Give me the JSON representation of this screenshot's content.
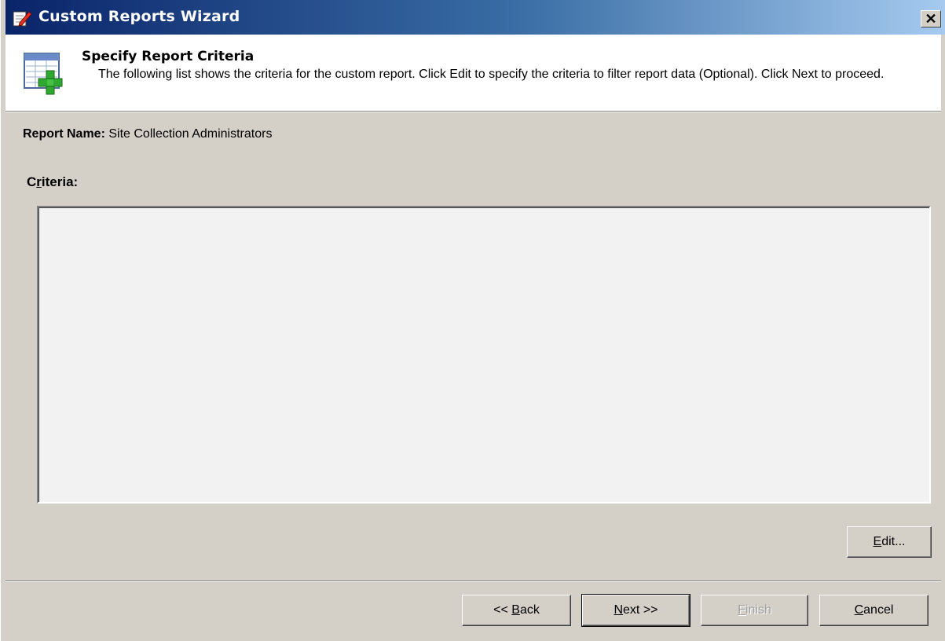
{
  "window": {
    "title": "Custom Reports Wizard",
    "close_label": "✕"
  },
  "header": {
    "title": "Specify Report Criteria",
    "description": "The following list shows the criteria for the custom report. Click Edit to specify the criteria to filter report data (Optional). Click Next to proceed."
  },
  "report": {
    "name_label": "Report Name:",
    "name_value": "Site Collection Administrators"
  },
  "criteria": {
    "label_prefix": "C",
    "label_accel": "r",
    "label_suffix": "iteria:",
    "items": []
  },
  "buttons": {
    "edit": {
      "accel": "E",
      "rest": "dit..."
    },
    "back": {
      "prefix": "<< ",
      "accel": "B",
      "rest": "ack"
    },
    "next": {
      "accel": "N",
      "rest": "ext >>"
    },
    "finish": {
      "accel": "F",
      "rest": "inish",
      "enabled": false
    },
    "cancel": {
      "accel": "C",
      "rest": "ancel"
    }
  },
  "icons": {
    "title_icon": "notepad-pencil-icon",
    "header_icon": "report-add-icon",
    "accent_green": "#2fa82f"
  }
}
